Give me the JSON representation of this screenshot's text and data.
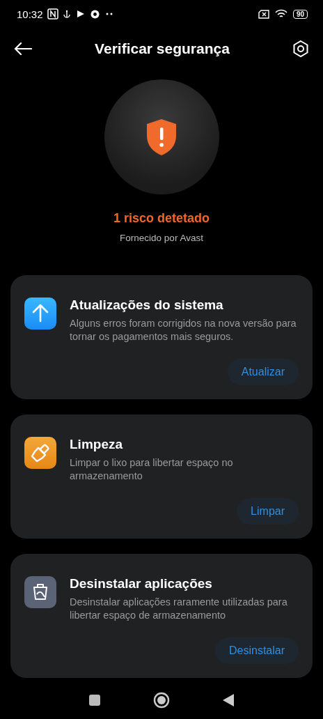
{
  "status_bar": {
    "time": "10:32",
    "battery": "90"
  },
  "header": {
    "title": "Verificar segurança"
  },
  "summary": {
    "headline": "1 risco detetado",
    "provider": "Fornecido por Avast"
  },
  "cards": [
    {
      "kind": "update",
      "title": "Atualizações do sistema",
      "description": "Alguns erros foram corrigidos na nova versão para tornar os pagamentos mais seguros.",
      "action": "Atualizar"
    },
    {
      "kind": "cleanup",
      "title": "Limpeza",
      "description": "Limpar o lixo para libertar espaço no armazenamento",
      "action": "Limpar"
    },
    {
      "kind": "uninstall",
      "title": "Desinstalar aplicações",
      "description": "Desinstalar aplicações raramente utilizadas para libertar espaço de armazenamento",
      "action": "Desinstalar"
    }
  ]
}
